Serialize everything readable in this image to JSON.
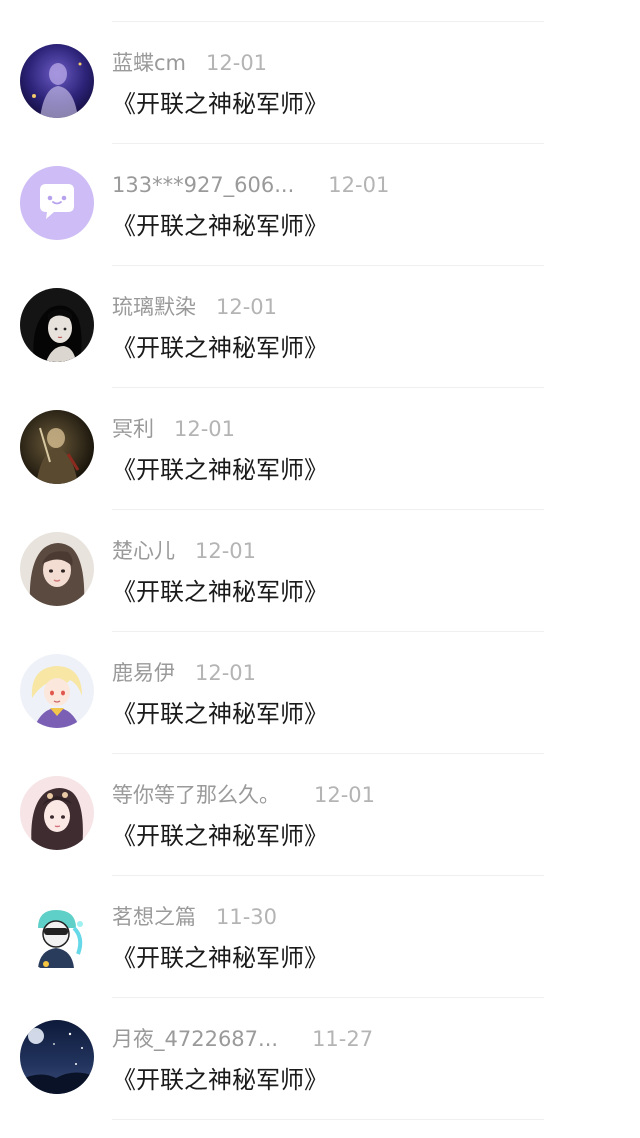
{
  "comments": [
    {
      "user": "蓝蝶cm",
      "date": "12-01",
      "text": "《开联之神秘军师》",
      "avatar": "purple-dark-portrait"
    },
    {
      "user": "133***927_606...",
      "date": "12-01",
      "text": "《开联之神秘军师》",
      "avatar": "lavender-chat-bubble"
    },
    {
      "user": "琉璃默染",
      "date": "12-01",
      "text": "《开联之神秘军师》",
      "avatar": "black-hair-anime-girl"
    },
    {
      "user": "冥利",
      "date": "12-01",
      "text": "《开联之神秘军师》",
      "avatar": "dark-warrior-art"
    },
    {
      "user": "楚心儿",
      "date": "12-01",
      "text": "《开联之神秘军师》",
      "avatar": "selfie-girl"
    },
    {
      "user": "鹿易伊",
      "date": "12-01",
      "text": "《开联之神秘军师》",
      "avatar": "blonde-anime-boy"
    },
    {
      "user": "等你等了那么久。",
      "date": "12-01",
      "text": "《开联之神秘军师》",
      "avatar": "pink-hanfu-girl"
    },
    {
      "user": "茗想之篇",
      "date": "11-30",
      "text": "《开联之神秘军师》",
      "avatar": "cyan-chibi-character"
    },
    {
      "user": "月夜_4722687...",
      "date": "11-27",
      "text": "《开联之神秘军师》",
      "avatar": "night-sky"
    }
  ],
  "colors": {
    "username": "#9a9a9a",
    "date": "#b4b4b4",
    "message": "#1a1a1a",
    "divider": "#efefef",
    "chat_avatar_bg": "#cdbcf5"
  }
}
